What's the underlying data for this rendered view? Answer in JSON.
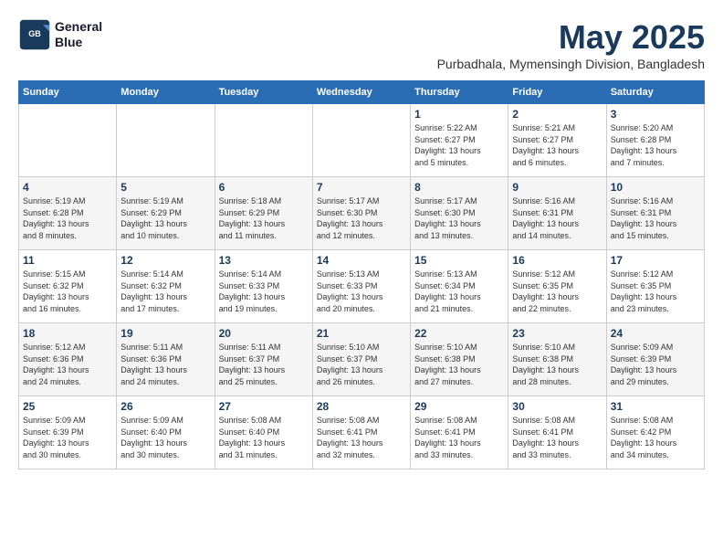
{
  "logo": {
    "line1": "General",
    "line2": "Blue"
  },
  "title": "May 2025",
  "location": "Purbadhala, Mymensingh Division, Bangladesh",
  "headers": [
    "Sunday",
    "Monday",
    "Tuesday",
    "Wednesday",
    "Thursday",
    "Friday",
    "Saturday"
  ],
  "weeks": [
    [
      {
        "day": "",
        "info": ""
      },
      {
        "day": "",
        "info": ""
      },
      {
        "day": "",
        "info": ""
      },
      {
        "day": "",
        "info": ""
      },
      {
        "day": "1",
        "info": "Sunrise: 5:22 AM\nSunset: 6:27 PM\nDaylight: 13 hours\nand 5 minutes."
      },
      {
        "day": "2",
        "info": "Sunrise: 5:21 AM\nSunset: 6:27 PM\nDaylight: 13 hours\nand 6 minutes."
      },
      {
        "day": "3",
        "info": "Sunrise: 5:20 AM\nSunset: 6:28 PM\nDaylight: 13 hours\nand 7 minutes."
      }
    ],
    [
      {
        "day": "4",
        "info": "Sunrise: 5:19 AM\nSunset: 6:28 PM\nDaylight: 13 hours\nand 8 minutes."
      },
      {
        "day": "5",
        "info": "Sunrise: 5:19 AM\nSunset: 6:29 PM\nDaylight: 13 hours\nand 10 minutes."
      },
      {
        "day": "6",
        "info": "Sunrise: 5:18 AM\nSunset: 6:29 PM\nDaylight: 13 hours\nand 11 minutes."
      },
      {
        "day": "7",
        "info": "Sunrise: 5:17 AM\nSunset: 6:30 PM\nDaylight: 13 hours\nand 12 minutes."
      },
      {
        "day": "8",
        "info": "Sunrise: 5:17 AM\nSunset: 6:30 PM\nDaylight: 13 hours\nand 13 minutes."
      },
      {
        "day": "9",
        "info": "Sunrise: 5:16 AM\nSunset: 6:31 PM\nDaylight: 13 hours\nand 14 minutes."
      },
      {
        "day": "10",
        "info": "Sunrise: 5:16 AM\nSunset: 6:31 PM\nDaylight: 13 hours\nand 15 minutes."
      }
    ],
    [
      {
        "day": "11",
        "info": "Sunrise: 5:15 AM\nSunset: 6:32 PM\nDaylight: 13 hours\nand 16 minutes."
      },
      {
        "day": "12",
        "info": "Sunrise: 5:14 AM\nSunset: 6:32 PM\nDaylight: 13 hours\nand 17 minutes."
      },
      {
        "day": "13",
        "info": "Sunrise: 5:14 AM\nSunset: 6:33 PM\nDaylight: 13 hours\nand 19 minutes."
      },
      {
        "day": "14",
        "info": "Sunrise: 5:13 AM\nSunset: 6:33 PM\nDaylight: 13 hours\nand 20 minutes."
      },
      {
        "day": "15",
        "info": "Sunrise: 5:13 AM\nSunset: 6:34 PM\nDaylight: 13 hours\nand 21 minutes."
      },
      {
        "day": "16",
        "info": "Sunrise: 5:12 AM\nSunset: 6:35 PM\nDaylight: 13 hours\nand 22 minutes."
      },
      {
        "day": "17",
        "info": "Sunrise: 5:12 AM\nSunset: 6:35 PM\nDaylight: 13 hours\nand 23 minutes."
      }
    ],
    [
      {
        "day": "18",
        "info": "Sunrise: 5:12 AM\nSunset: 6:36 PM\nDaylight: 13 hours\nand 24 minutes."
      },
      {
        "day": "19",
        "info": "Sunrise: 5:11 AM\nSunset: 6:36 PM\nDaylight: 13 hours\nand 24 minutes."
      },
      {
        "day": "20",
        "info": "Sunrise: 5:11 AM\nSunset: 6:37 PM\nDaylight: 13 hours\nand 25 minutes."
      },
      {
        "day": "21",
        "info": "Sunrise: 5:10 AM\nSunset: 6:37 PM\nDaylight: 13 hours\nand 26 minutes."
      },
      {
        "day": "22",
        "info": "Sunrise: 5:10 AM\nSunset: 6:38 PM\nDaylight: 13 hours\nand 27 minutes."
      },
      {
        "day": "23",
        "info": "Sunrise: 5:10 AM\nSunset: 6:38 PM\nDaylight: 13 hours\nand 28 minutes."
      },
      {
        "day": "24",
        "info": "Sunrise: 5:09 AM\nSunset: 6:39 PM\nDaylight: 13 hours\nand 29 minutes."
      }
    ],
    [
      {
        "day": "25",
        "info": "Sunrise: 5:09 AM\nSunset: 6:39 PM\nDaylight: 13 hours\nand 30 minutes."
      },
      {
        "day": "26",
        "info": "Sunrise: 5:09 AM\nSunset: 6:40 PM\nDaylight: 13 hours\nand 30 minutes."
      },
      {
        "day": "27",
        "info": "Sunrise: 5:08 AM\nSunset: 6:40 PM\nDaylight: 13 hours\nand 31 minutes."
      },
      {
        "day": "28",
        "info": "Sunrise: 5:08 AM\nSunset: 6:41 PM\nDaylight: 13 hours\nand 32 minutes."
      },
      {
        "day": "29",
        "info": "Sunrise: 5:08 AM\nSunset: 6:41 PM\nDaylight: 13 hours\nand 33 minutes."
      },
      {
        "day": "30",
        "info": "Sunrise: 5:08 AM\nSunset: 6:41 PM\nDaylight: 13 hours\nand 33 minutes."
      },
      {
        "day": "31",
        "info": "Sunrise: 5:08 AM\nSunset: 6:42 PM\nDaylight: 13 hours\nand 34 minutes."
      }
    ]
  ]
}
